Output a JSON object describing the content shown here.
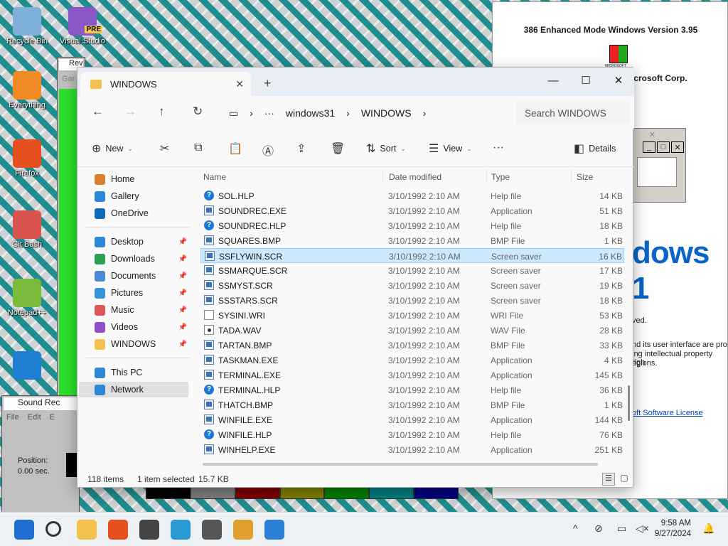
{
  "desktop": {
    "icons": [
      {
        "label": "Recycle Bin",
        "color": "#7fb0d8"
      },
      {
        "label": "Visual Studio",
        "color": "#8a56c8",
        "badge": "PRE"
      },
      {
        "label": "Everything",
        "color": "#f08a24"
      },
      {
        "label": "Firefox",
        "color": "#e6501e"
      },
      {
        "label": "Git Bash",
        "color": "#d9534f"
      },
      {
        "label": "Notepad++",
        "color": "#7cba3c"
      },
      {
        "label": "",
        "color": "#1f7fd4"
      }
    ]
  },
  "bg_windows": {
    "reversi_title": "Reversi",
    "reversi_menu": "Gar",
    "sound_title": "Sound Rec",
    "sound_menu": [
      "File",
      "Edit",
      "E"
    ],
    "position_label": "Position:",
    "position_value": "0.00 sec.",
    "about_version": "386 Enhanced Mode Windows Version 3.95",
    "about_copyright": "icrosoft Corp.",
    "about_logo": "MICROSOFT WINDOWS",
    "about_big": "dows 1",
    "about_lines": [
      "ved.",
      "nd its user interface are pro",
      "ing intellectual property righ",
      "egions."
    ],
    "about_license": "oft Software License",
    "palette": [
      "#000000",
      "#808080",
      "#800000",
      "#808000",
      "#008000",
      "#008080",
      "#000080"
    ]
  },
  "explorer": {
    "tab_title": "WINDOWS",
    "new_tab": "+",
    "breadcrumb": [
      "windows31",
      "WINDOWS"
    ],
    "search_placeholder": "Search WINDOWS",
    "toolbar": {
      "new": "New",
      "sort": "Sort",
      "view": "View",
      "details": "Details"
    },
    "sidebar": {
      "top": [
        {
          "label": "Home",
          "color": "#d9822b"
        },
        {
          "label": "Gallery",
          "color": "#2b88d8"
        },
        {
          "label": "OneDrive",
          "color": "#0f6cbd"
        }
      ],
      "pinned": [
        {
          "label": "Desktop",
          "color": "#2f86d6"
        },
        {
          "label": "Downloads",
          "color": "#2e9e57"
        },
        {
          "label": "Documents",
          "color": "#4b8bd4"
        },
        {
          "label": "Pictures",
          "color": "#3a95d8"
        },
        {
          "label": "Music",
          "color": "#e0585b"
        },
        {
          "label": "Videos",
          "color": "#8e4fc7"
        },
        {
          "label": "WINDOWS",
          "color": "#f2c14e"
        }
      ],
      "bottom": [
        {
          "label": "This PC",
          "color": "#2f86d6"
        },
        {
          "label": "Network",
          "color": "#2f86d6"
        }
      ]
    },
    "columns": {
      "name": "Name",
      "date": "Date modified",
      "type": "Type",
      "size": "Size"
    },
    "files": [
      {
        "name": "SOL.HLP",
        "date": "3/10/1992 2:10 AM",
        "type": "Help file",
        "size": "14 KB",
        "icon": "help"
      },
      {
        "name": "SOUNDREC.EXE",
        "date": "3/10/1992 2:10 AM",
        "type": "Application",
        "size": "51 KB",
        "icon": "app"
      },
      {
        "name": "SOUNDREC.HLP",
        "date": "3/10/1992 2:10 AM",
        "type": "Help file",
        "size": "18 KB",
        "icon": "help"
      },
      {
        "name": "SQUARES.BMP",
        "date": "3/10/1992 2:10 AM",
        "type": "BMP File",
        "size": "1 KB",
        "icon": "app"
      },
      {
        "name": "SSFLYWIN.SCR",
        "date": "3/10/1992 2:10 AM",
        "type": "Screen saver",
        "size": "16 KB",
        "icon": "app"
      },
      {
        "name": "SSMARQUE.SCR",
        "date": "3/10/1992 2:10 AM",
        "type": "Screen saver",
        "size": "17 KB",
        "icon": "app"
      },
      {
        "name": "SSMYST.SCR",
        "date": "3/10/1992 2:10 AM",
        "type": "Screen saver",
        "size": "19 KB",
        "icon": "app"
      },
      {
        "name": "SSSTARS.SCR",
        "date": "3/10/1992 2:10 AM",
        "type": "Screen saver",
        "size": "18 KB",
        "icon": "app"
      },
      {
        "name": "SYSINI.WRI",
        "date": "3/10/1992 2:10 AM",
        "type": "WRI File",
        "size": "53 KB",
        "icon": "doc"
      },
      {
        "name": "TADA.WAV",
        "date": "3/10/1992 2:10 AM",
        "type": "WAV File",
        "size": "28 KB",
        "icon": "wav"
      },
      {
        "name": "TARTAN.BMP",
        "date": "3/10/1992 2:10 AM",
        "type": "BMP File",
        "size": "33 KB",
        "icon": "app"
      },
      {
        "name": "TASKMAN.EXE",
        "date": "3/10/1992 2:10 AM",
        "type": "Application",
        "size": "4 KB",
        "icon": "app"
      },
      {
        "name": "TERMINAL.EXE",
        "date": "3/10/1992 2:10 AM",
        "type": "Application",
        "size": "145 KB",
        "icon": "app"
      },
      {
        "name": "TERMINAL.HLP",
        "date": "3/10/1992 2:10 AM",
        "type": "Help file",
        "size": "36 KB",
        "icon": "help"
      },
      {
        "name": "THATCH.BMP",
        "date": "3/10/1992 2:10 AM",
        "type": "BMP File",
        "size": "1 KB",
        "icon": "app"
      },
      {
        "name": "WINFILE.EXE",
        "date": "3/10/1992 2:10 AM",
        "type": "Application",
        "size": "144 KB",
        "icon": "app"
      },
      {
        "name": "WINFILE.HLP",
        "date": "3/10/1992 2:10 AM",
        "type": "Help file",
        "size": "76 KB",
        "icon": "help"
      },
      {
        "name": "WINHELP.EXE",
        "date": "3/10/1992 2:10 AM",
        "type": "Application",
        "size": "251 KB",
        "icon": "app"
      }
    ],
    "selected_index": 4,
    "status": {
      "count": "118 items",
      "selected": "1 item selected",
      "size": "15.7 KB"
    }
  },
  "taskbar": {
    "apps": [
      {
        "name": "start",
        "color": "#1f6fd1"
      },
      {
        "name": "search",
        "color": "#333333"
      },
      {
        "name": "file-explorer",
        "color": "#f2c14e"
      },
      {
        "name": "firefox",
        "color": "#e6501e"
      },
      {
        "name": "terminal",
        "color": "#444444"
      },
      {
        "name": "notepad",
        "color": "#2a9ad4"
      },
      {
        "name": "sound-recorder",
        "color": "#555555"
      },
      {
        "name": "paint",
        "color": "#e0a030"
      },
      {
        "name": "photos",
        "color": "#2b7fd8"
      }
    ],
    "time": "9:58 AM",
    "date": "9/27/2024"
  }
}
